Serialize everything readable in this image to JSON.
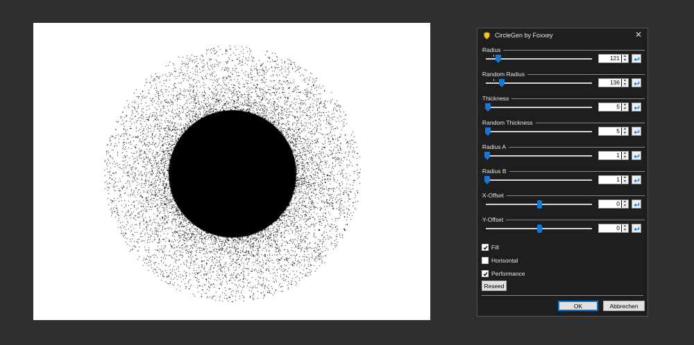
{
  "dialog": {
    "title": "CircleGen by Foxxey",
    "controls": [
      {
        "label": "Radius",
        "value": "121",
        "slider_fraction": 0.12,
        "tick_fraction": 0.07,
        "thumb": "pointed"
      },
      {
        "label": "Random Radius",
        "value": "136",
        "slider_fraction": 0.15,
        "tick_fraction": 0.07,
        "thumb": "pointed"
      },
      {
        "label": "Thickness",
        "value": "5",
        "slider_fraction": 0.02,
        "tick_fraction": null,
        "thumb": "pointed"
      },
      {
        "label": "Random Thickness",
        "value": "5",
        "slider_fraction": 0.02,
        "tick_fraction": null,
        "thumb": "pointed"
      },
      {
        "label": "Radius A",
        "value": "1",
        "slider_fraction": 0.01,
        "tick_fraction": null,
        "thumb": "pointed"
      },
      {
        "label": "Radius B",
        "value": "1",
        "slider_fraction": 0.01,
        "tick_fraction": null,
        "thumb": "pointed"
      },
      {
        "label": "X-Offset",
        "value": "0",
        "slider_fraction": 0.5,
        "tick_fraction": null,
        "thumb": "round"
      },
      {
        "label": "Y-Offset",
        "value": "0",
        "slider_fraction": 0.5,
        "tick_fraction": null,
        "thumb": "round"
      }
    ],
    "checks": [
      {
        "label": "Fill",
        "checked": true
      },
      {
        "label": "Horisontal",
        "checked": false
      },
      {
        "label": "Performance",
        "checked": true
      }
    ],
    "reseed_label": "Reseed",
    "ok_label": "OK",
    "cancel_label": "Abbrechen"
  },
  "colors": {
    "accent": "#1478d4",
    "dialog_bg": "#1e1e1e",
    "workspace_bg": "#303030"
  },
  "icons": {
    "app": "yellow-shield-icon",
    "close": "close-icon",
    "reset": "undo-arrow-icon"
  }
}
